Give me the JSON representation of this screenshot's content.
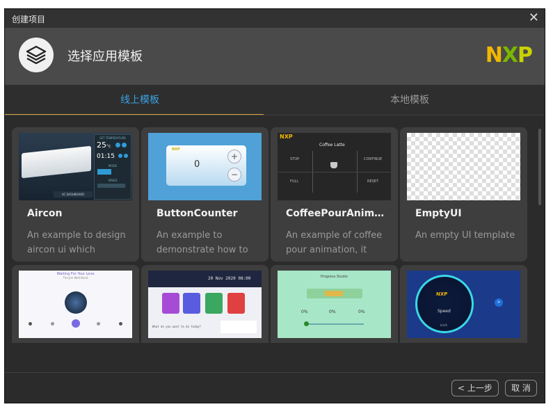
{
  "window": {
    "title": "创建项目",
    "close_icon": "close-icon"
  },
  "header": {
    "title": "选择应用模板",
    "brand": "NXP"
  },
  "tabs": [
    {
      "label": "线上模板",
      "active": true
    },
    {
      "label": "本地模板",
      "active": false
    }
  ],
  "cards": [
    {
      "title": "Aircon",
      "desc": "An example to design aircon ui which includes"
    },
    {
      "title": "ButtonCounter",
      "desc": "An example to demonstrate how to"
    },
    {
      "title": "CoffeePourAnimat...",
      "desc": "An example of coffee pour animation, it"
    },
    {
      "title": "EmptyUI",
      "desc": "An empty UI template"
    },
    {
      "title": "",
      "desc": ""
    },
    {
      "title": "",
      "desc": ""
    },
    {
      "title": "",
      "desc": ""
    },
    {
      "title": "",
      "desc": ""
    }
  ],
  "thumbs": {
    "aircon": {
      "set_temp": "SET TEMPERATURE",
      "temp": "25",
      "unit": "°c",
      "time": "01:15",
      "mode": "MODE",
      "speed": "SPEED",
      "footer": "AC DASHBOARD"
    },
    "counter": {
      "value": "0",
      "plus": "+",
      "minus": "−",
      "brand": "NXP"
    },
    "coffee": {
      "brand": "NXP",
      "name": "Coffee Latte",
      "stop": "STOP",
      "cont": "CONTINUE",
      "full": "FULL",
      "reset": "RESET"
    },
    "music": {
      "title": "Waiting For Your Love",
      "artist": "The Jim Well Band"
    },
    "smart": {
      "date": "20 Nov 2020 08:00",
      "prompt": "What do you want to do today?"
    },
    "progress": {
      "title": "Progress Studio",
      "p1": "0%",
      "p2": "0%",
      "p3": "0%"
    },
    "speed": {
      "label": "Speed",
      "unit": "km/h",
      "brand": "NXP"
    }
  },
  "footer": {
    "prev_label": "上一步",
    "prev_icon": "chevron-left-icon",
    "cancel_label": "取 消"
  },
  "colors": {
    "accent": "#3aa3e3",
    "underline": "#d9a441",
    "nxp_n": "#f2b700",
    "nxp_x": "#7ab800",
    "nxp_p": "#c9d200"
  }
}
